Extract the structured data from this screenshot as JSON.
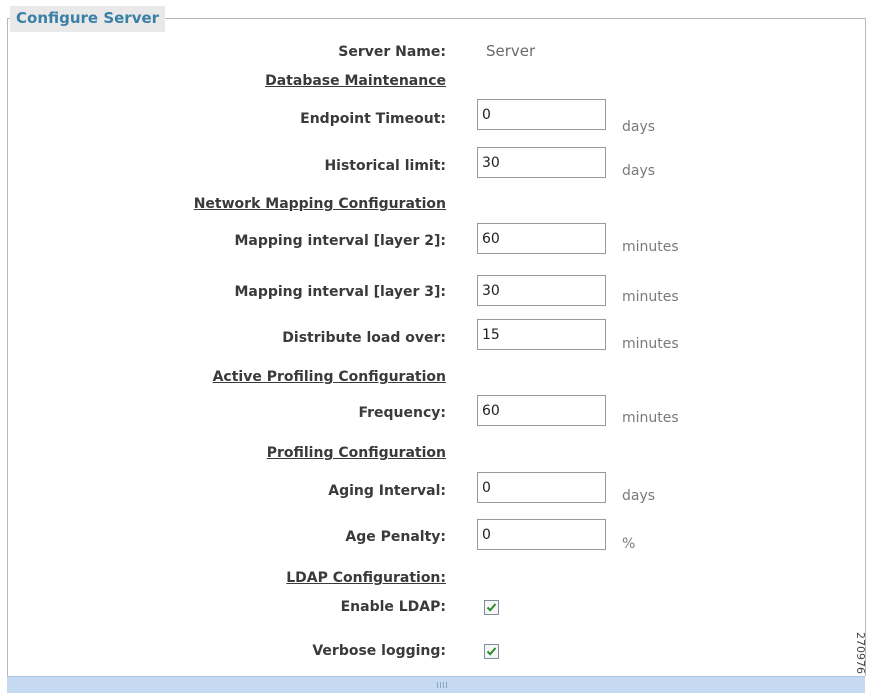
{
  "panel": {
    "title": "Configure Server"
  },
  "server": {
    "name_label": "Server Name:",
    "name_value": "Server"
  },
  "database_maintenance": {
    "heading": "Database Maintenance",
    "endpoint_timeout": {
      "label": "Endpoint Timeout:",
      "value": "0",
      "unit": "days"
    },
    "historical_limit": {
      "label": "Historical limit:",
      "value": "30",
      "unit": "days"
    }
  },
  "network_mapping": {
    "heading": "Network Mapping Configuration",
    "layer2": {
      "label": "Mapping interval [layer 2]:",
      "value": "60",
      "unit": "minutes"
    },
    "layer3": {
      "label": "Mapping interval [layer 3]:",
      "value": "30",
      "unit": "minutes"
    },
    "distribute": {
      "label": "Distribute load over:",
      "value": "15",
      "unit": "minutes"
    }
  },
  "active_profiling": {
    "heading": "Active Profiling Configuration",
    "frequency": {
      "label": "Frequency:",
      "value": "60",
      "unit": "minutes"
    }
  },
  "profiling": {
    "heading": "Profiling Configuration",
    "aging_interval": {
      "label": "Aging Interval:",
      "value": "0",
      "unit": "days"
    },
    "age_penalty": {
      "label": "Age Penalty:",
      "value": "0",
      "unit": "%"
    }
  },
  "ldap": {
    "heading": "LDAP Configuration:",
    "enable": {
      "label": "Enable LDAP:",
      "checked": true
    },
    "verbose": {
      "label": "Verbose logging:",
      "checked": true
    }
  },
  "colors": {
    "title": "#3a7fa5",
    "bottom_bar": "#c5d9f1",
    "check_mark": "#2e8b2e"
  },
  "figure_id": "270976"
}
